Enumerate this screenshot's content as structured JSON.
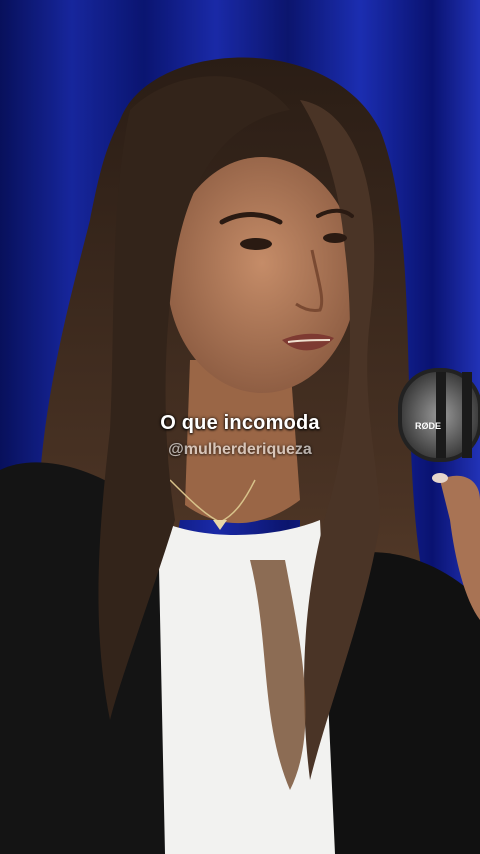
{
  "video": {
    "subtitle": "O que incomoda",
    "watermark": "@mulherderiqueza",
    "mic_brand": "RØDE"
  },
  "colors": {
    "curtain": "#1a2fc8",
    "jacket": "#121212",
    "shirt": "#f2f2f0",
    "hair": "#3a2a1e",
    "skin": "#b07a5a"
  }
}
